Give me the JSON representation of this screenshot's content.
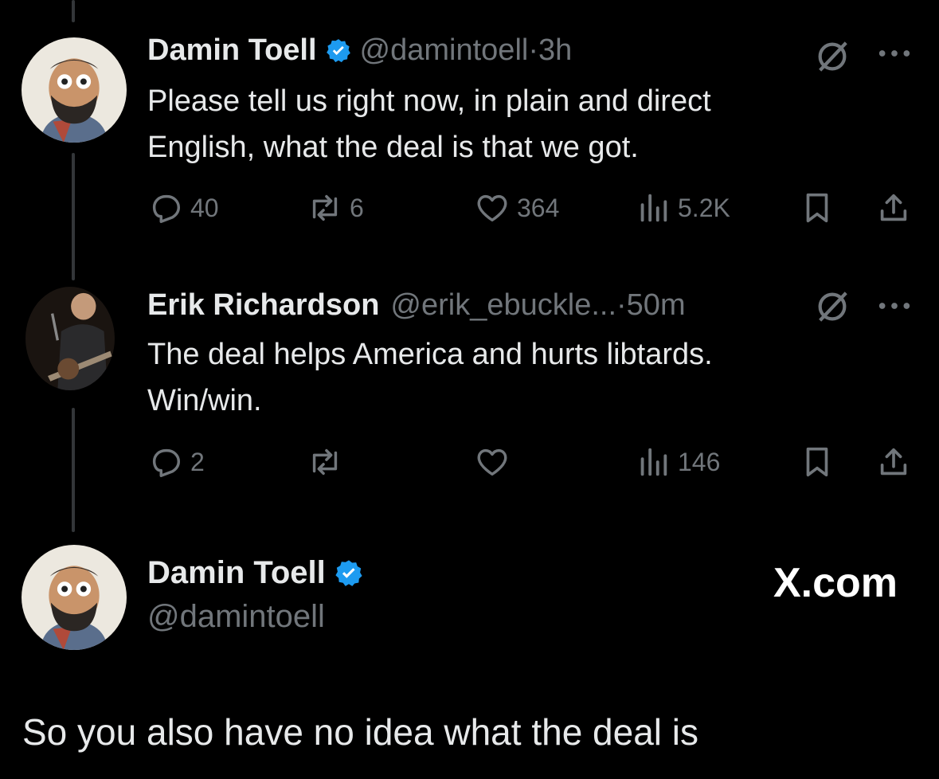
{
  "tweet1": {
    "name": "Damin Toell",
    "handle": "@damintoell",
    "time": "·3h",
    "text_line1": "Please tell us right now, in plain and direct",
    "text_line2": "English, what the deal is that we got.",
    "replies": "40",
    "reposts": "6",
    "likes": "364",
    "views": "5.2K"
  },
  "tweet2": {
    "name": "Erik Richardson",
    "handle": "@erik_ebuckle...",
    "time": "·50m",
    "text_line1": "The deal helps America and hurts libtards.",
    "text_line2": "Win/win.",
    "replies": "2",
    "views": "146"
  },
  "quote_card": {
    "name": "Damin Toell",
    "handle": "@damintoell",
    "brand": "X.com"
  },
  "caption": "So you also have no idea what the deal is",
  "colors": {
    "background": "#000000",
    "text": "#e7e9ea",
    "muted": "#71767b",
    "verified": "#1d9bf0",
    "thread_line": "#333639"
  }
}
